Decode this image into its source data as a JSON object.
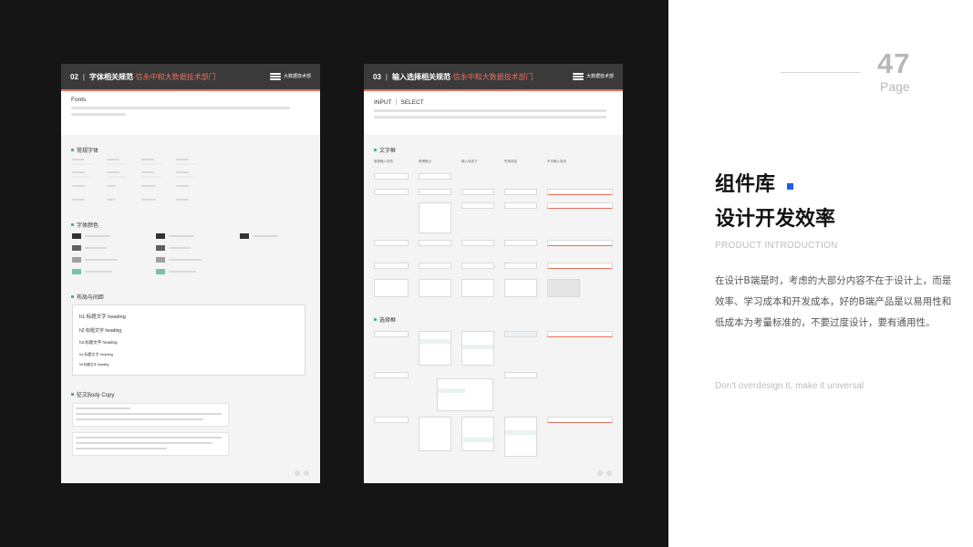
{
  "page": {
    "number": "47",
    "word": "Page"
  },
  "heading": {
    "line1": "组件库",
    "line2": "设计开发效率",
    "subtitle": "PRODUCT INTRODUCTION"
  },
  "description": "在设计B端是时，考虑的大部分内容不在于设计上，而是效率、学习成本和开发成本，好的B端产品是以易用性和低成本为考量标准的，不要过度设计，要有通用性。",
  "motto": "Don't overdesign it, make it universal",
  "colors": {
    "accent": "#1f5fe6",
    "header_line": "#e8705a",
    "section_dot": "#4ab38a"
  },
  "cards": [
    {
      "num": "02",
      "sep": "|",
      "title": "字体相关规范",
      "org": "-信永中和大数据技术部门",
      "logo": "大数据技术部",
      "intro_heading": "Fonts",
      "sections": [
        "常规字体",
        "字体颜色",
        "布局与间距",
        "征文Body Copy"
      ],
      "headings": [
        "h1.标题文字 heading",
        "h2.标题文字 heading",
        "h3.标题文字 heading",
        "h4.标题文字 heading",
        "h5.标题文字 heading"
      ]
    },
    {
      "num": "03",
      "sep": "|",
      "title": "输入选择相关规范",
      "org": "-信永中和大数据技术部门",
      "logo": "大数据技术部",
      "intro_heading": "INPUT ｜ SELECT",
      "sections": [
        "文字框",
        "选择框"
      ],
      "columns": [
        "常规输入状态",
        "获得焦点",
        "输入状态下",
        "失效状态",
        "不可输入状态"
      ]
    }
  ]
}
